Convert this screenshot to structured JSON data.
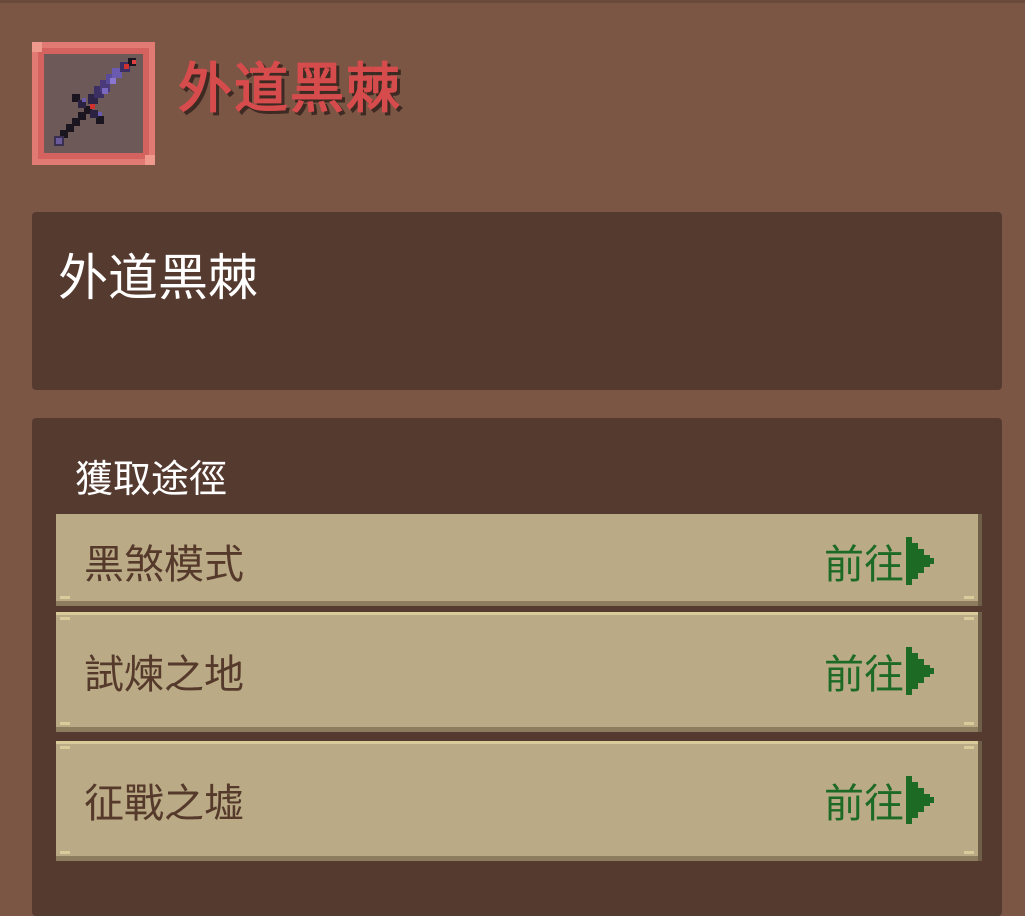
{
  "item": {
    "name": "外道黑棘",
    "icon": "dark-spear-icon"
  },
  "description": {
    "text": "外道黑棘"
  },
  "sources": {
    "title": "獲取途徑",
    "items": [
      {
        "label": "黑煞模式",
        "action": "前往"
      },
      {
        "label": "試煉之地",
        "action": "前往"
      },
      {
        "label": "征戰之墟",
        "action": "前往"
      }
    ]
  },
  "colors": {
    "title_red": "#d64b4b",
    "goto_green": "#1d6a25",
    "panel_bg": "#553a30",
    "row_bg": "#baab86"
  }
}
